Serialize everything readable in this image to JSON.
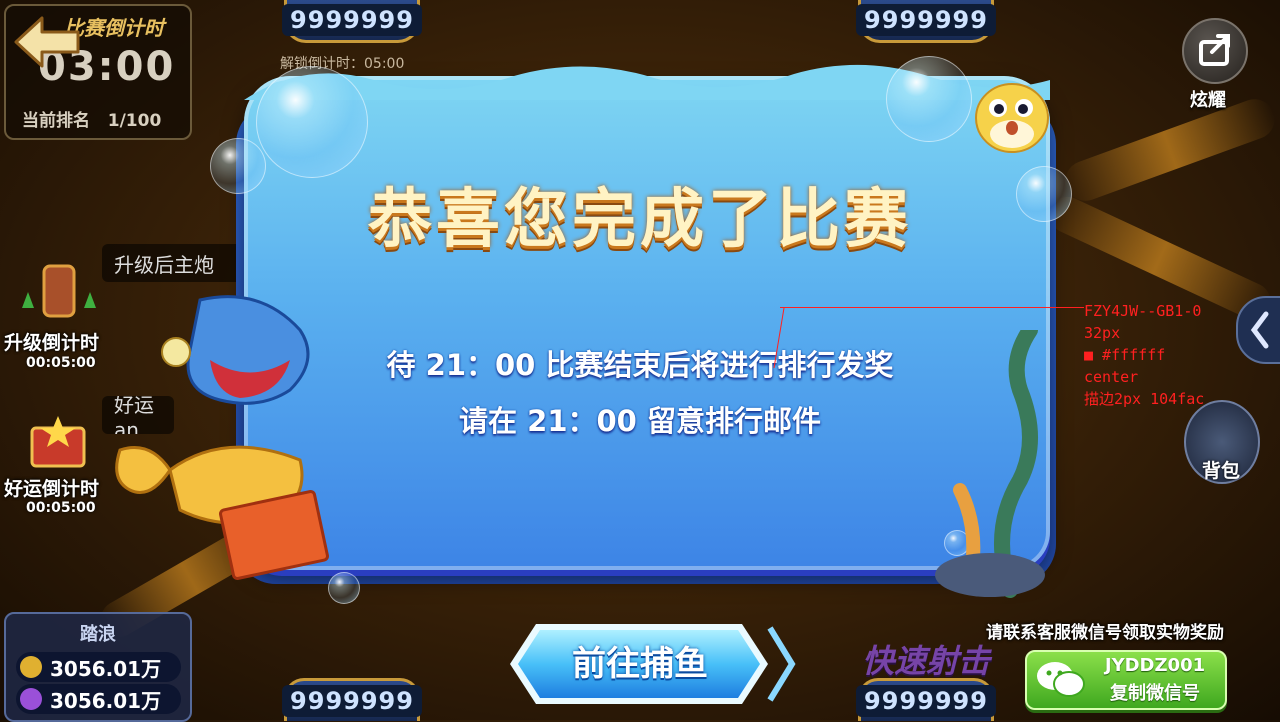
{
  "top_counters": {
    "left_value": "9999999",
    "right_value": "9999999",
    "unlock_countdown": "解锁倒计时：05:00"
  },
  "timer_panel": {
    "title": "比赛倒计时",
    "time": "03:00",
    "rank_label": "当前排名",
    "rank_value": "1/100"
  },
  "share": {
    "label": "炫耀",
    "icon": "share-icon"
  },
  "left_side": {
    "upgrade_hint": "升级后主炮",
    "upgrade_label": "升级倒计时",
    "upgrade_time": "00:05:00",
    "luck_hint": "好运an",
    "luck_label": "好运倒计时",
    "luck_time": "00:05:00"
  },
  "player": {
    "name": "踏浪",
    "coin_value": "3056.01万",
    "gem_value": "3056.01万"
  },
  "dialog": {
    "title": "恭喜您完成了比赛",
    "line1": "待 21：00 比赛结束后将进行排行发奖",
    "line2": "请在 21：00 留意排行邮件"
  },
  "annotation": [
    "FZY4JW--GB1-0",
    "32px",
    "■ #ffffff",
    "center",
    "描边2px 104fac"
  ],
  "go_button": {
    "label": "前往捕鱼"
  },
  "fast_shoot": "快速射击",
  "bottom_counters": {
    "left_value": "9999999",
    "right_value": "9999999"
  },
  "bag": {
    "label": "背包"
  },
  "contact": {
    "text": "请联系客服微信号领取实物奖励",
    "wechat_id": "JYDDZ001",
    "copy_label": "复制微信号"
  },
  "colors": {
    "dialog_top": "#7fd6f3",
    "dialog_bottom": "#3d84e6",
    "title_gold": "#fff3c4",
    "stroke_blue": "#104fac",
    "wechat_green": "#3fa81f"
  }
}
